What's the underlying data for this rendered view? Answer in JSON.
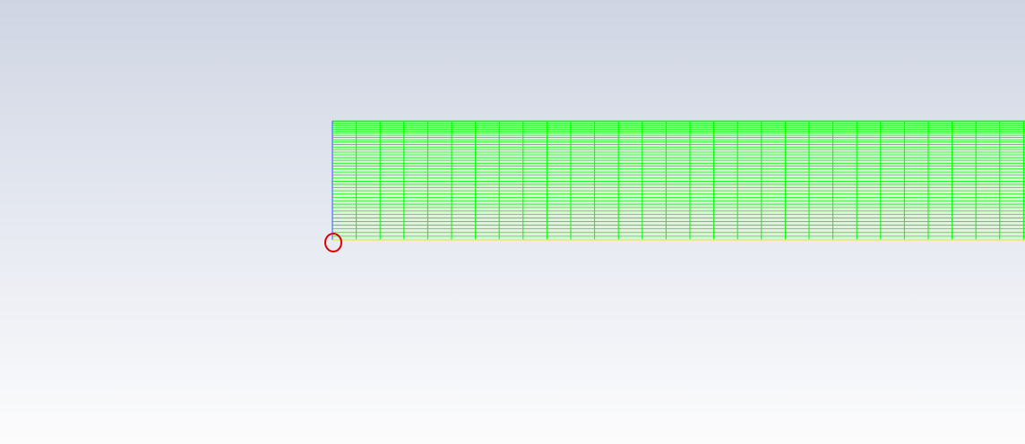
{
  "viewport": {
    "background_top": "#cfd5e3",
    "background_bottom": "#fcfcfd"
  },
  "mesh": {
    "line_color": "#00ff00",
    "fill_color": "#ddf3dd",
    "axis_edge_color": "#5b6cf0",
    "wall_edge_color": "#e8e84a",
    "vertical_lines": 30,
    "horizontal_lines": 44
  },
  "highlight": {
    "icon": "circle-marker-icon",
    "color": "#e00000"
  }
}
